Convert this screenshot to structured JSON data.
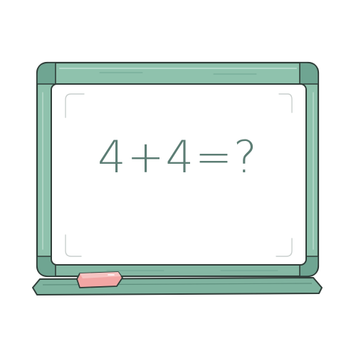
{
  "board": {
    "equation": "4+4=?"
  },
  "colors": {
    "frame": "#8fc2ad",
    "frame_dark": "#6fa592",
    "outline": "#2f3d38",
    "surface": "#ffffff",
    "ink": "#5c7d74",
    "eraser": "#f2a6a4"
  },
  "icons": {
    "eraser": "eraser-icon"
  }
}
